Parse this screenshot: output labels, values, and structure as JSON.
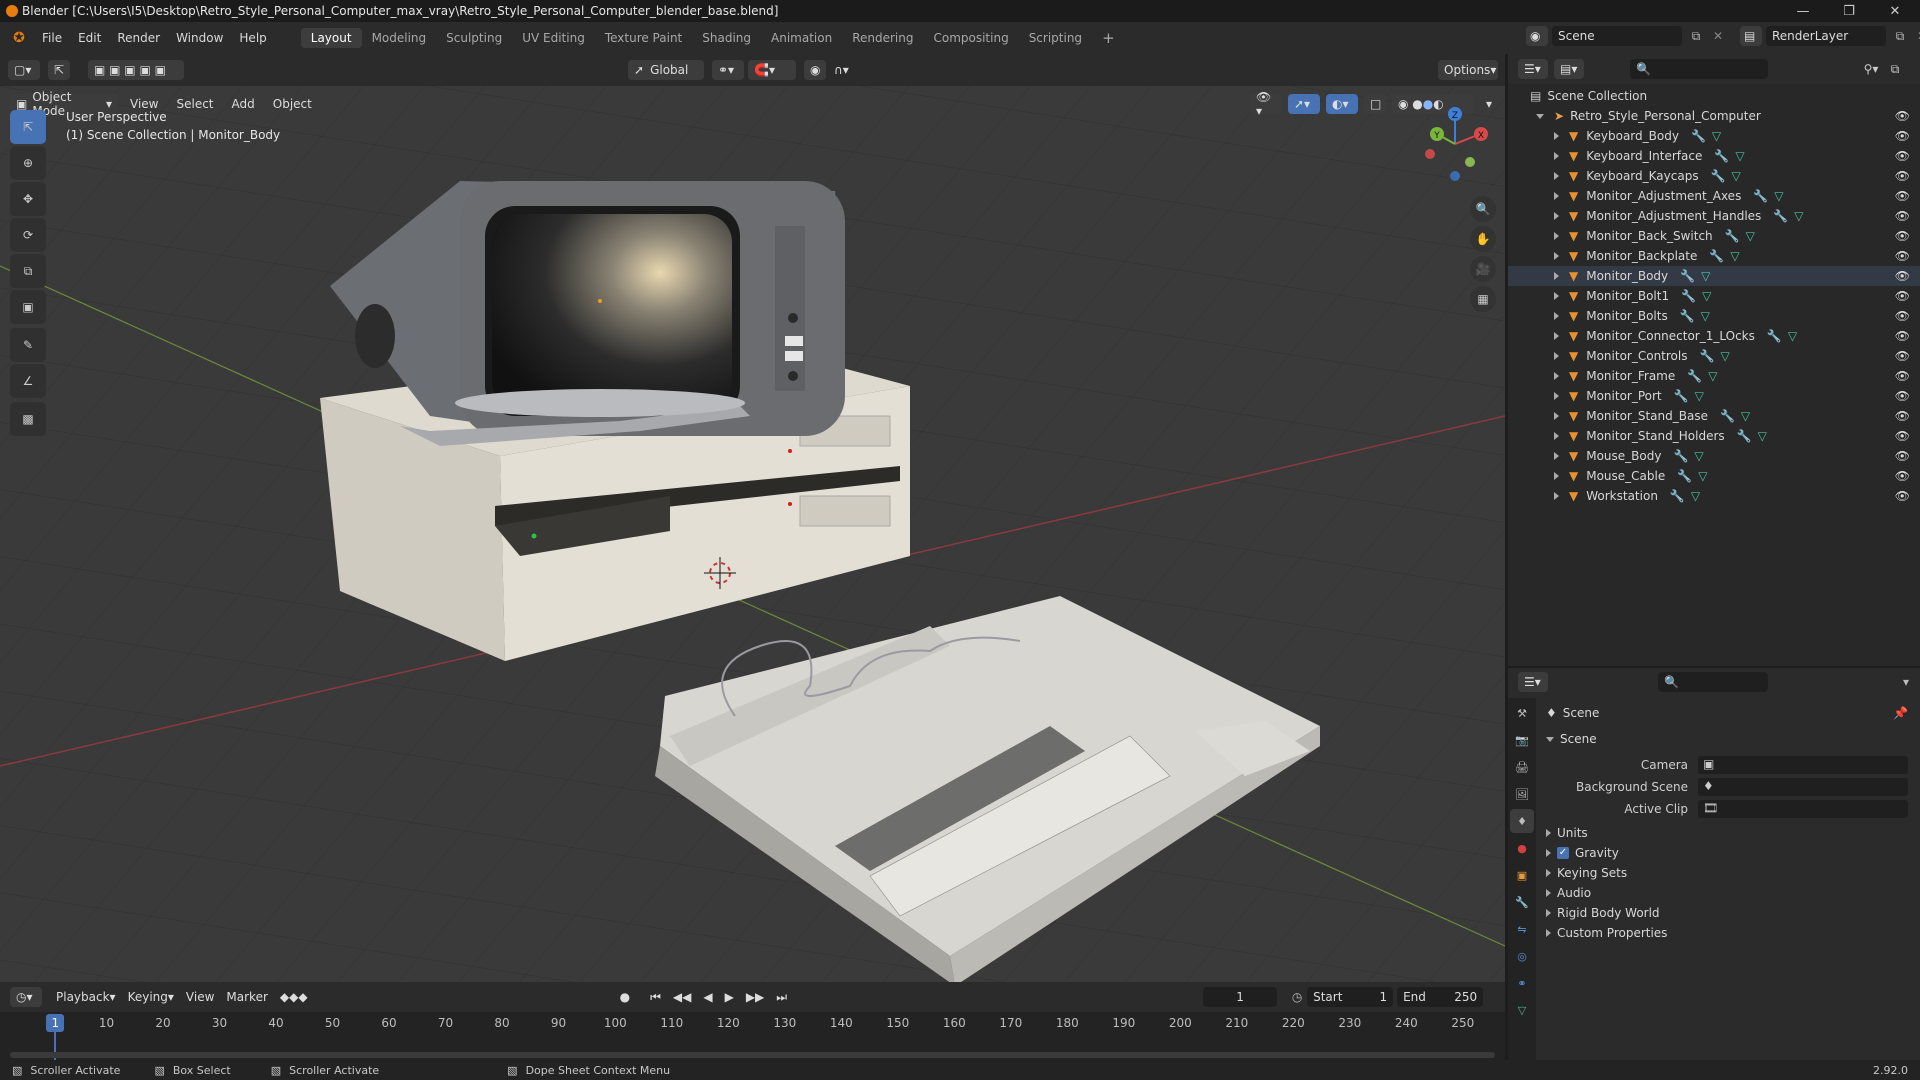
{
  "titlebar": {
    "title": "Blender [C:\\Users\\I5\\Desktop\\Retro_Style_Personal_Computer_max_vray\\Retro_Style_Personal_Computer_blender_base.blend]"
  },
  "menu": [
    "File",
    "Edit",
    "Render",
    "Window",
    "Help"
  ],
  "workspaces": [
    {
      "label": "Layout",
      "active": true
    },
    {
      "label": "Modeling"
    },
    {
      "label": "Sculpting"
    },
    {
      "label": "UV Editing"
    },
    {
      "label": "Texture Paint"
    },
    {
      "label": "Shading"
    },
    {
      "label": "Animation"
    },
    {
      "label": "Rendering"
    },
    {
      "label": "Compositing"
    },
    {
      "label": "Scripting"
    }
  ],
  "topright": {
    "scene": "Scene",
    "renderlayer": "RenderLayer"
  },
  "header": {
    "transform": "Global",
    "options": "Options",
    "mode": "Object Mode",
    "menus": [
      "View",
      "Select",
      "Add",
      "Object"
    ]
  },
  "viewport": {
    "perspective": "User Perspective",
    "collection": "(1) Scene Collection | Monitor_Body",
    "gizmo": {
      "x": "X",
      "y": "Y",
      "z": "Z"
    }
  },
  "outliner": {
    "root": "Scene Collection",
    "collection": "Retro_Style_Personal_Computer",
    "items": [
      "Keyboard_Body",
      "Keyboard_Interface",
      "Keyboard_Kaycaps",
      "Monitor_Adjustment_Axes",
      "Monitor_Adjustment_Handles",
      "Monitor_Back_Switch",
      "Monitor_Backplate",
      "Monitor_Body",
      "Monitor_Bolt1",
      "Monitor_Bolts",
      "Monitor_Connector_1_LOcks",
      "Monitor_Controls",
      "Monitor_Frame",
      "Monitor_Port",
      "Monitor_Stand_Base",
      "Monitor_Stand_Holders",
      "Mouse_Body",
      "Mouse_Cable",
      "Workstation"
    ]
  },
  "properties": {
    "context": "Scene",
    "panel": "Scene",
    "fields": [
      {
        "label": "Camera"
      },
      {
        "label": "Background Scene"
      },
      {
        "label": "Active Clip"
      }
    ],
    "sections": [
      "Units",
      "Gravity",
      "Keying Sets",
      "Audio",
      "Rigid Body World",
      "Custom Properties"
    ]
  },
  "timeline": {
    "menus": [
      "Playback",
      "Keying",
      "View",
      "Marker"
    ],
    "current": "1",
    "start_label": "Start",
    "start": "1",
    "end_label": "End",
    "end": "250",
    "ticks": [
      "1",
      "10",
      "20",
      "30",
      "40",
      "50",
      "60",
      "70",
      "80",
      "90",
      "100",
      "110",
      "120",
      "130",
      "140",
      "150",
      "160",
      "170",
      "180",
      "190",
      "200",
      "210",
      "220",
      "230",
      "240",
      "250"
    ]
  },
  "status": {
    "items": [
      "Scroller Activate",
      "Box Select",
      "Scroller Activate",
      "Dope Sheet Context Menu"
    ],
    "version": "2.92.0"
  },
  "colors": {
    "accent": "#4772b3",
    "orange": "#e87d0d",
    "grid": "#393939"
  }
}
